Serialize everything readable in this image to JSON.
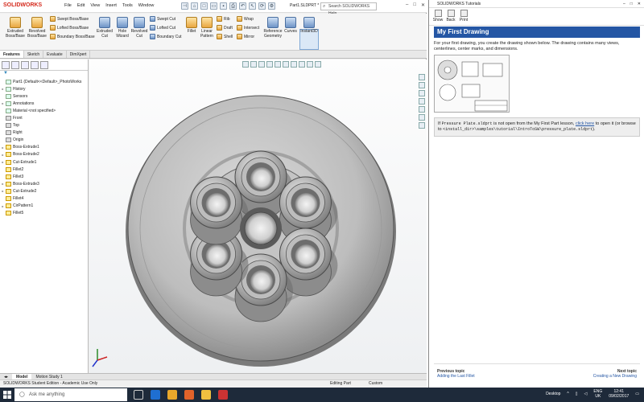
{
  "app": {
    "logo_text": "SOLIDWORKS",
    "menu": [
      "File",
      "Edit",
      "View",
      "Insert",
      "Tools",
      "Window"
    ],
    "document_name": "Part1.SLDPRT *",
    "search_placeholder": "Search SOLIDWORKS Help"
  },
  "ribbon": {
    "extruded_boss": "Extruded Boss/Base",
    "revolved_boss": "Revolved Boss/Base",
    "swept_boss": "Swept Boss/Base",
    "lofted_boss": "Lofted Boss/Base",
    "boundary_boss": "Boundary Boss/Base",
    "extruded_cut": "Extruded Cut",
    "hole_wizard": "Hole Wizard",
    "revolved_cut": "Revolved Cut",
    "swept_cut": "Swept Cut",
    "lofted_cut": "Lofted Cut",
    "boundary_cut": "Boundary Cut",
    "fillet": "Fillet",
    "linear_pattern": "Linear Pattern",
    "rib": "Rib",
    "draft": "Draft",
    "shell": "Shell",
    "wrap": "Wrap",
    "intersect": "Intersect",
    "mirror": "Mirror",
    "reference_geometry": "Reference Geometry",
    "curves": "Curves",
    "instant3d": "Instant3D"
  },
  "command_tabs": [
    "Features",
    "Sketch",
    "Evaluate",
    "DimXpert"
  ],
  "feature_tree": [
    {
      "label": "Part1  (Default<<Default>_PhotoWorks",
      "expand": ""
    },
    {
      "label": "History",
      "expand": "▸"
    },
    {
      "label": "Sensors",
      "expand": ""
    },
    {
      "label": "Annotations",
      "expand": "▸"
    },
    {
      "label": "Material <not specified>",
      "expand": ""
    },
    {
      "label": "Front",
      "expand": ""
    },
    {
      "label": "Top",
      "expand": ""
    },
    {
      "label": "Right",
      "expand": ""
    },
    {
      "label": "Origin",
      "expand": ""
    },
    {
      "label": "Boss-Extrude1",
      "expand": "▸"
    },
    {
      "label": "Boss-Extrude2",
      "expand": "▸"
    },
    {
      "label": "Cut-Extrude1",
      "expand": "▸"
    },
    {
      "label": "Fillet2",
      "expand": ""
    },
    {
      "label": "Fillet3",
      "expand": ""
    },
    {
      "label": "Boss-Extrude3",
      "expand": "▸"
    },
    {
      "label": "Cut-Extrude2",
      "expand": "▸"
    },
    {
      "label": "Fillet4",
      "expand": ""
    },
    {
      "label": "CirPattern1",
      "expand": "▸"
    },
    {
      "label": "Fillet5",
      "expand": ""
    }
  ],
  "bottom_tabs": [
    "Model",
    "Motion Study 1"
  ],
  "status": {
    "left": "SOLIDWORKS Student Edition - Academic Use Only",
    "middle": "Editing Part",
    "right": "Custom"
  },
  "tutorial": {
    "window_title": "SOLIDWORKS Tutorials",
    "toolbar": [
      "Show",
      "Back",
      "Print"
    ],
    "heading": "My First Drawing",
    "intro": "For your first drawing, you create the drawing shown below. The drawing contains many views, centerlines, center marks, and dimensions.",
    "note_prefix": "If ",
    "note_file": "Pressure Plate.sldprt",
    "note_mid": " is not open from the My First Part lesson, ",
    "note_link": "click here",
    "note_after": " to open it (or browse to",
    "note_path": "<install_dir>\\samples\\tutorial\\IntroToSW\\pressure_plate.sldprt",
    "note_end": ").",
    "prev_title": "Previous topic",
    "prev_link": "Adding the Last Fillet",
    "next_title": "Next topic",
    "next_link": "Creating a New Drawing"
  },
  "taskbar": {
    "search_placeholder": "Ask me anything",
    "desktop": "Desktop",
    "lang": "ENG",
    "region": "UK",
    "time": "12:41",
    "date": "09/02/2017"
  },
  "colors": {
    "tutorial_header": "#2456a4",
    "taskbar": "#1e2a3a",
    "solidworks_red": "#d52b1e"
  }
}
